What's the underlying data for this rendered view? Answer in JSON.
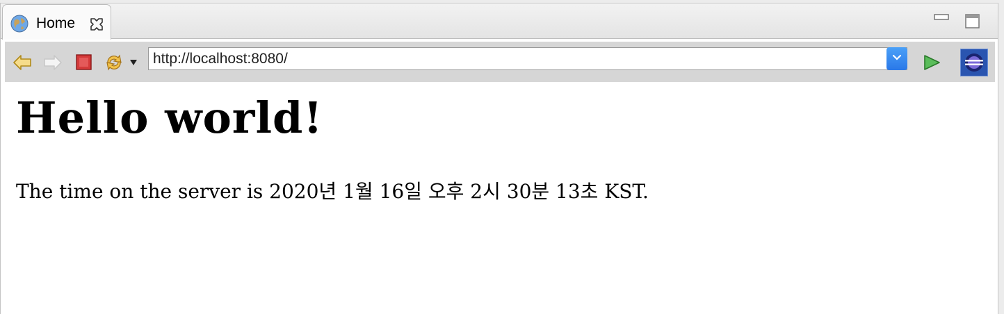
{
  "tab": {
    "title": "Home",
    "icon": "globe-icon"
  },
  "toolbar": {
    "back_icon": "back-arrow-icon",
    "forward_icon": "forward-arrow-icon",
    "stop_icon": "stop-icon",
    "refresh_icon": "refresh-icon",
    "url": "http://localhost:8080/",
    "go_icon": "go-icon",
    "browser_icon": "eclipse-icon"
  },
  "page": {
    "heading": "Hello world!",
    "time_text": "The time on the server is 2020년 1월 16일 오후 2시 30분 13초 KST."
  },
  "colors": {
    "url_dropdown": "#2a78e8",
    "go_green": "#3aa03a",
    "stop_red": "#d43a3a"
  }
}
